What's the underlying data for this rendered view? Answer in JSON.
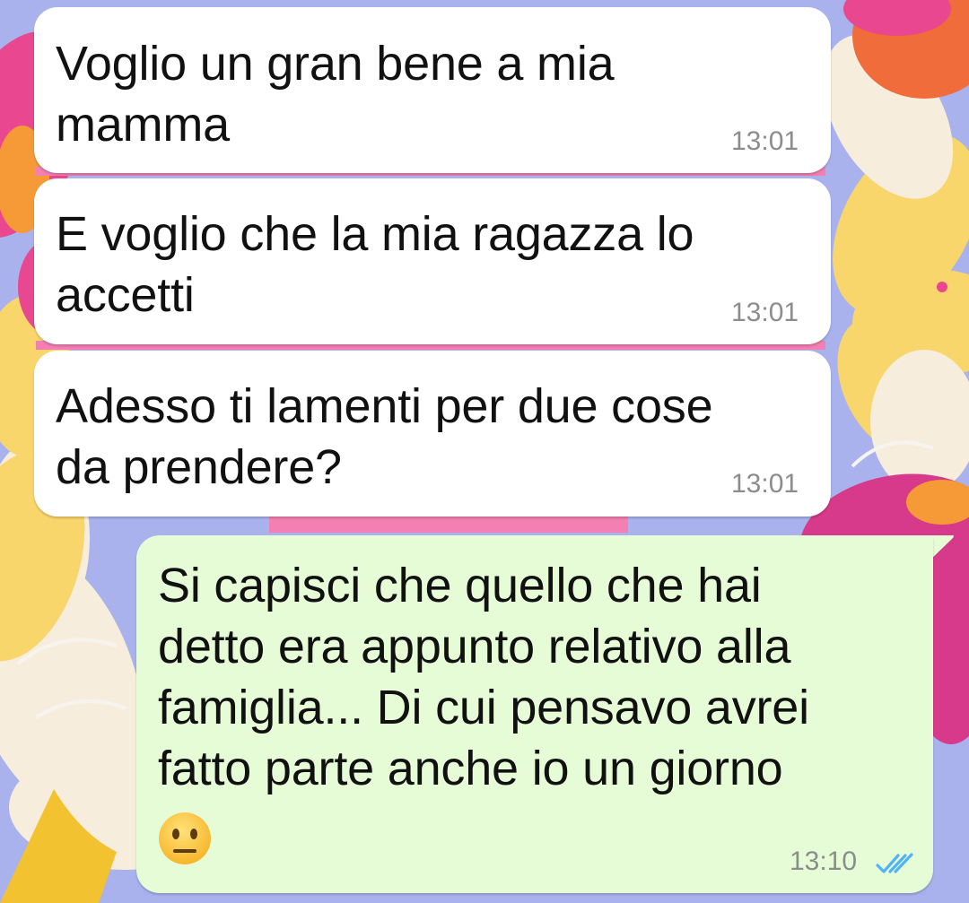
{
  "messages": [
    {
      "direction": "incoming",
      "text": "Voglio un gran bene a mia\nmamma",
      "time": "13:01"
    },
    {
      "direction": "incoming",
      "text": "E voglio che la mia ragazza lo\naccetti",
      "time": "13:01"
    },
    {
      "direction": "incoming",
      "text": "Adesso ti lamenti per due cose\nda prendere?",
      "time": "13:01"
    },
    {
      "direction": "outgoing",
      "text": "Si capisci che quello che hai\ndetto era appunto relativo alla\nfamiglia... Di cui pensavo avrei\nfatto parte anche io un giorno",
      "emoji": "neutral-face",
      "time": "13:10",
      "status": "read"
    }
  ],
  "colors": {
    "incoming_bubble": "#ffffff",
    "outgoing_bubble": "#e6fcd7",
    "timestamp": "#8c8c8c",
    "read_ticks": "#4fb3f6",
    "wallpaper_base": "#a9b2ec"
  }
}
